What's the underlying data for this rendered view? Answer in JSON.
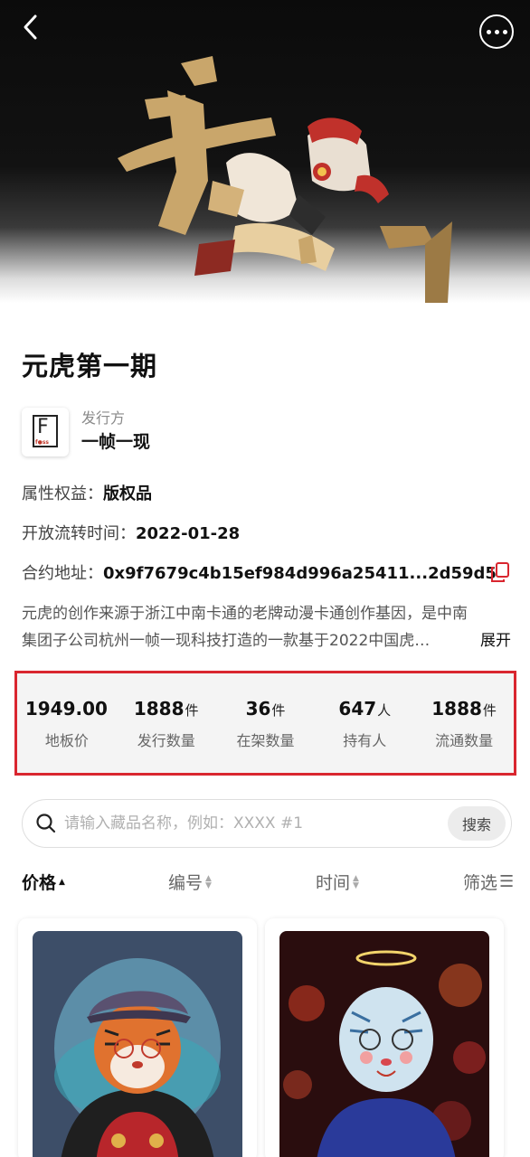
{
  "header": {
    "back_icon": "chevron-left-icon",
    "more_icon": "more-horizontal-icon"
  },
  "collection": {
    "title": "元虎第一期",
    "issuer_label": "发行方",
    "issuer_name": "一帧一现",
    "issuer_logo_letter": "F",
    "attr_label": "属性权益：",
    "attr_value": "版权品",
    "time_label": "开放流转时间：",
    "time_value": "2022-01-28",
    "addr_label": "合约地址：",
    "addr_value": "0x9f7679c4b15ef984d996a25411...2d59d5",
    "desc_line1": "元虎的创作来源于浙江中南卡通的老牌动漫卡通创作基因，是中南",
    "desc_line2": "集团子公司杭州一帧一现科技打造的一款基于2022中国虎…",
    "expand_label": "展开"
  },
  "stats": [
    {
      "value": "1949.00",
      "unit": "",
      "label": "地板价"
    },
    {
      "value": "1888",
      "unit": "件",
      "label": "发行数量"
    },
    {
      "value": "36",
      "unit": "件",
      "label": "在架数量"
    },
    {
      "value": "647",
      "unit": "人",
      "label": "持有人"
    },
    {
      "value": "1888",
      "unit": "件",
      "label": "流通数量"
    }
  ],
  "search": {
    "placeholder": "请输入藏品名称，例如：XXXX #1",
    "button_label": "搜索"
  },
  "sort": {
    "price": "价格",
    "number": "编号",
    "time": "时间",
    "filter": "筛选"
  },
  "colors": {
    "highlight_border": "#d9262f",
    "copy_icon": "#d9262f"
  }
}
